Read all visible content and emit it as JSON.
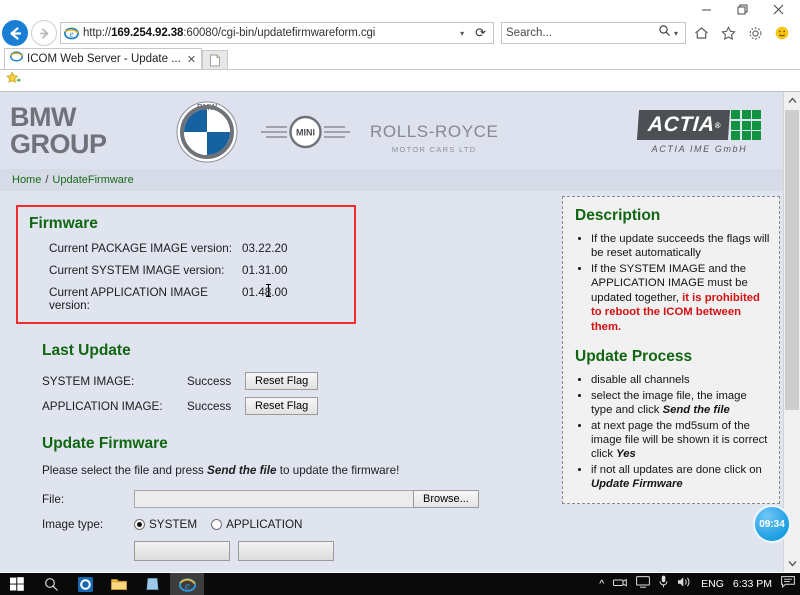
{
  "browser": {
    "window_controls": {
      "minimize": "minimize-icon",
      "restore": "restore-icon",
      "close": "close-icon"
    },
    "back": "back-arrow-icon",
    "forward": "forward-arrow-icon",
    "address": {
      "protocol": "http://",
      "host": "169.254.92.38",
      "rest": ":60080/cgi-bin/updatefirmwareform.cgi"
    },
    "address_full": "http://169.254.92.38:60080/cgi-bin/updatefirmwareform.cgi",
    "dropdown_caret": "▾",
    "reload": "⟳",
    "search_placeholder": "Search...",
    "tab_title": "ICOM Web Server - Update ...",
    "tab_close": "✕",
    "new_tab": "new-tab-icon",
    "tools": [
      "home-icon",
      "favorites-star-icon",
      "settings-gear-icon",
      "feedback-smiley-icon"
    ]
  },
  "banner": {
    "group_line1": "BMW",
    "group_line2": "GROUP",
    "bmw_letters": "BMW",
    "mini_text": "MINI",
    "rolls_main": "ROLLS-ROYCE",
    "rolls_sub": "MOTOR CARS LTD",
    "actia_word": "ACTIA",
    "actia_reg": "®",
    "actia_sub": "ACTIA IME GmbH"
  },
  "breadcrumb": {
    "home": "Home",
    "separator": "/",
    "current": "UpdateFirmware"
  },
  "firmware": {
    "title": "Firmware",
    "rows": [
      {
        "label": "Current PACKAGE IMAGE version:",
        "value": "03.22.20"
      },
      {
        "label": "Current SYSTEM IMAGE version:",
        "value": "01.31.00"
      },
      {
        "label": "Current APPLICATION IMAGE version:",
        "value": "01.48.00"
      }
    ]
  },
  "last_update": {
    "title": "Last Update",
    "rows": [
      {
        "name": "SYSTEM IMAGE:",
        "status": "Success",
        "button": "Reset Flag"
      },
      {
        "name": "APPLICATION IMAGE:",
        "status": "Success",
        "button": "Reset Flag"
      }
    ]
  },
  "update_firmware": {
    "title": "Update Firmware",
    "intro_pre": "Please select the file and press ",
    "intro_strong": "Send the file",
    "intro_post": " to update the firmware!",
    "file_label": "File:",
    "file_value": "",
    "browse_label": "Browse...",
    "image_type_label": "Image type:",
    "options": [
      {
        "label": "SYSTEM",
        "selected": true
      },
      {
        "label": "APPLICATION",
        "selected": false
      }
    ]
  },
  "description": {
    "title": "Description",
    "items": [
      {
        "text": "If the update succeeds the flags will be reset automatically"
      },
      {
        "pre": "If the SYSTEM IMAGE and the APPLICATION IMAGE must be updated together, ",
        "danger": "it is prohibited to reboot the ICOM between them."
      }
    ]
  },
  "update_process": {
    "title": "Update Process",
    "items": [
      {
        "text": "disable all channels"
      },
      {
        "pre": "select the image file, the image type and click ",
        "strong": "Send the file",
        "post": ""
      },
      {
        "pre": "at next page the md5sum of the image file will be shown it is correct click ",
        "strong": "Yes",
        "post": ""
      },
      {
        "pre": "if not all updates are done click on ",
        "strong": "Update Firmware",
        "post": ""
      }
    ]
  },
  "overlay": {
    "recorder_time": "09:34"
  },
  "taskbar": {
    "items": [
      "windows-start-icon",
      "search-icon",
      "cortana-icon",
      "file-explorer-icon",
      "store-icon",
      "internet-explorer-icon"
    ],
    "tray_chevron": "^",
    "language": "ENG",
    "clock": "6:33 PM"
  },
  "colors": {
    "accent_green": "#116611",
    "danger_red": "#d31111",
    "banner_bg": "#dde2ee",
    "page_bg": "#dfe4ef"
  }
}
